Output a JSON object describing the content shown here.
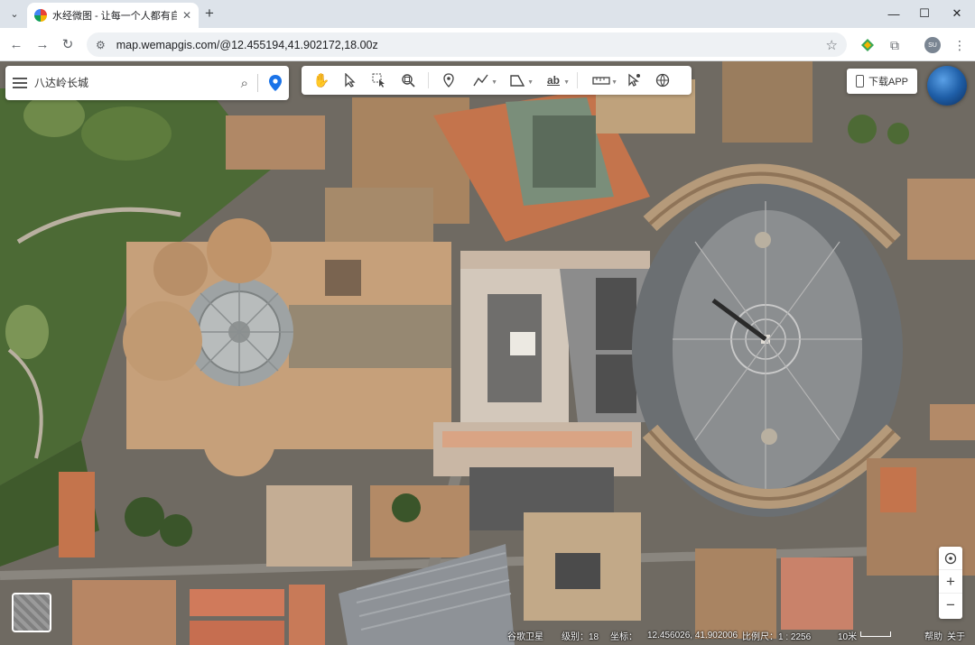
{
  "browser": {
    "tab_title": "水经微图 - 让每一个人都有自己",
    "url": "map.wemapgis.com/@12.455194,41.902172,18.00z",
    "profile_initials": "SU"
  },
  "search": {
    "placeholder": "八达岭长城"
  },
  "tools": {
    "label_tool_text": "ab"
  },
  "download_app": {
    "label": "下载APP"
  },
  "zoom": {
    "in": "+",
    "out": "−"
  },
  "status": {
    "layer": "谷歌卫星",
    "level_label": "级别：18",
    "coord_label": "坐标：",
    "coordinates": "12.456026, 41.902006",
    "scale_ratio": "比例尺：1 : 2256",
    "scale_text": "10米",
    "help": "帮助",
    "about": "关于"
  },
  "colors": {
    "map_base": "#6f6a62",
    "roof_terracotta": "#c8744f",
    "piazza": "#8f8f8f",
    "accent_blue": "#1a73e8"
  },
  "icons": {
    "search": "search-icon",
    "locate": "location-pin-icon",
    "menu": "menu-icon",
    "hand": "hand-icon",
    "select": "cursor-icon",
    "zoom_box": "zoom-box-icon",
    "point": "marker-icon",
    "polyline": "polyline-icon",
    "polygon": "polygon-icon",
    "label": "text-label-icon",
    "measure": "ruler-icon",
    "identify": "identify-icon",
    "globe": "globe-icon",
    "compass": "compass-icon"
  }
}
